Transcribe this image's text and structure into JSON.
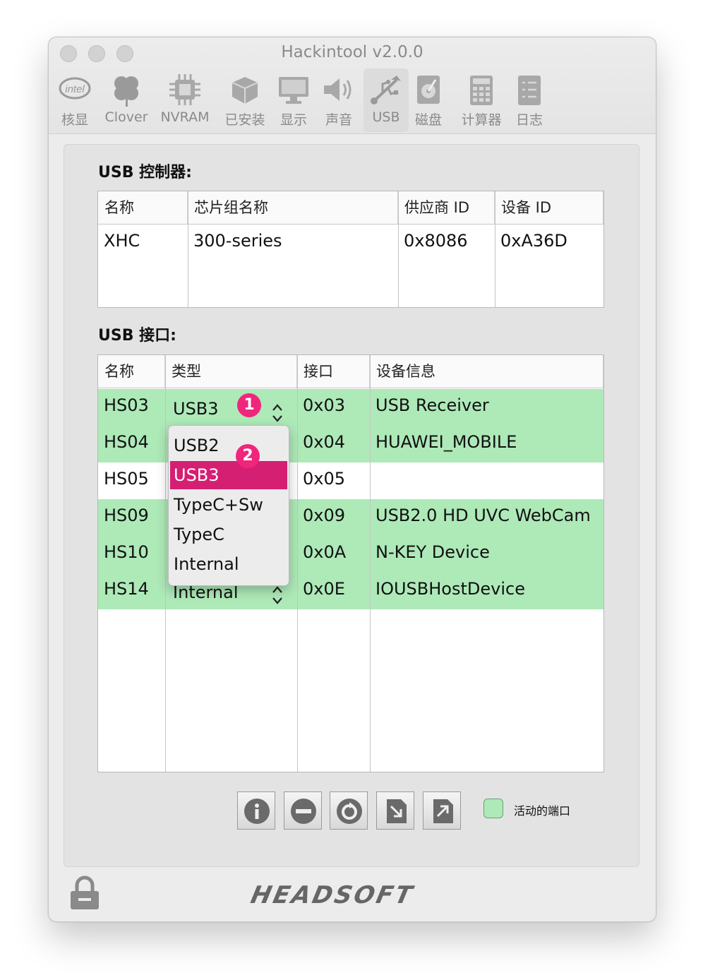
{
  "window": {
    "title": "Hackintool v2.0.0"
  },
  "toolbar": {
    "items": [
      {
        "label": "核显",
        "icon": "intel-icon"
      },
      {
        "label": "Clover",
        "icon": "clover-icon"
      },
      {
        "label": "NVRAM",
        "icon": "chip-icon"
      },
      {
        "label": "已安装",
        "icon": "package-icon"
      },
      {
        "label": "显示",
        "icon": "monitor-icon"
      },
      {
        "label": "声音",
        "icon": "speaker-icon"
      },
      {
        "label": "USB",
        "icon": "usb-icon",
        "active": true
      },
      {
        "label": "磁盘",
        "icon": "disk-icon"
      },
      {
        "label": "计算器",
        "icon": "calculator-icon"
      },
      {
        "label": "日志",
        "icon": "log-icon"
      }
    ]
  },
  "controllers": {
    "section_title": "USB 控制器:",
    "headers": [
      "名称",
      "芯片组名称",
      "供应商 ID",
      "设备 ID"
    ],
    "rows": [
      {
        "name": "XHC",
        "chipset": "300-series",
        "vendor_id": "0x8086",
        "device_id": "0xA36D"
      }
    ]
  },
  "ports": {
    "section_title": "USB 接口:",
    "headers": [
      "名称",
      "类型",
      "接口",
      "设备信息"
    ],
    "rows": [
      {
        "name": "HS03",
        "type": "USB3",
        "port": "0x03",
        "device": "USB Receiver",
        "active": true
      },
      {
        "name": "HS04",
        "type": "",
        "port": "0x04",
        "device": "HUAWEI_MOBILE",
        "active": true
      },
      {
        "name": "HS05",
        "type": "",
        "port": "0x05",
        "device": "",
        "active": false
      },
      {
        "name": "HS09",
        "type": "",
        "port": "0x09",
        "device": "USB2.0 HD UVC WebCam",
        "active": true
      },
      {
        "name": "HS10",
        "type": "",
        "port": "0x0A",
        "device": "N-KEY Device",
        "active": true
      },
      {
        "name": "HS14",
        "type": "Internal",
        "port": "0x0E",
        "device": "IOUSBHostDevice",
        "active": true
      }
    ]
  },
  "type_popup": {
    "options": [
      "USB2",
      "USB3",
      "TypeC+Sw",
      "TypeC",
      "Internal"
    ],
    "selected": "USB3"
  },
  "badges": {
    "first": "1",
    "second": "2"
  },
  "legend": {
    "label": "活动的端口",
    "color": "#aee9b8"
  },
  "bottom_buttons": [
    "info-icon",
    "remove-icon",
    "refresh-icon",
    "import-icon",
    "export-icon"
  ],
  "footer": {
    "brand": "HEADSOFT"
  },
  "colors": {
    "active_row": "#aee9b8",
    "selection": "#d51f72",
    "badge": "#f0267c"
  }
}
